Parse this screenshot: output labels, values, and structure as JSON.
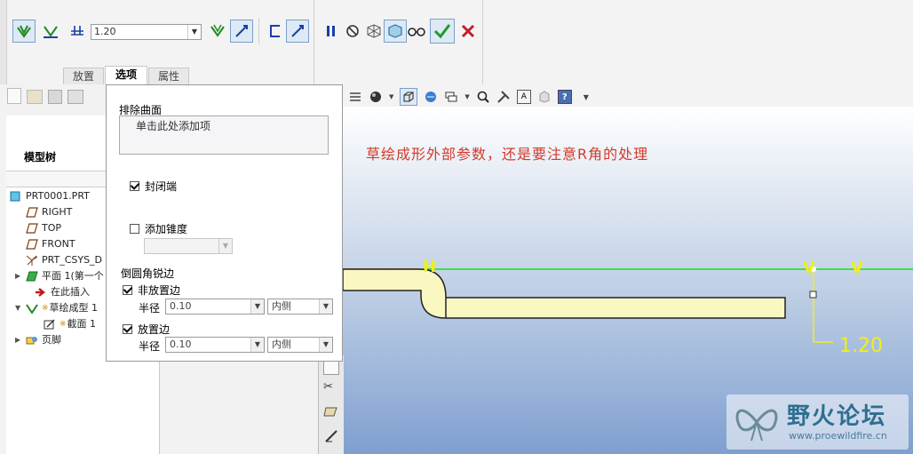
{
  "dashboard": {
    "dim_value": "1.20",
    "tabs": [
      {
        "label": "放置",
        "active": false
      },
      {
        "label": "选项",
        "active": true
      },
      {
        "label": "属性",
        "active": false
      }
    ]
  },
  "model_tree": {
    "title": "模型树",
    "items": [
      {
        "label": "PRT0001.PRT",
        "icon": "part-icon"
      },
      {
        "label": "RIGHT",
        "icon": "datum-plane-icon"
      },
      {
        "label": "TOP",
        "icon": "datum-plane-icon"
      },
      {
        "label": "FRONT",
        "icon": "datum-plane-icon"
      },
      {
        "label": "PRT_CSYS_D",
        "icon": "csys-icon"
      },
      {
        "label": "平面 1(第一个",
        "icon": "plane-feature-icon"
      },
      {
        "label": "在此插入",
        "icon": "insert-arrow-icon"
      },
      {
        "label": "草绘成型 1",
        "icon": "sketch-form-icon"
      },
      {
        "label": "截面 1",
        "icon": "section-icon"
      },
      {
        "label": "页脚",
        "icon": "footer-icon"
      }
    ]
  },
  "options_panel": {
    "exclude_surfaces_label": "排除曲面",
    "exclude_surfaces_placeholder": "单击此处添加项",
    "closed_ends_label": "封闭端",
    "closed_ends_checked": true,
    "add_taper_label": "添加锥度",
    "add_taper_checked": false,
    "taper_value": "",
    "round_edges_label": "倒圆角锐边",
    "non_placement_label": "非放置边",
    "non_placement_checked": true,
    "radius_label": "半径",
    "non_placement_radius": "0.10",
    "non_placement_side": "内侧",
    "placement_label": "放置边",
    "placement_checked": true,
    "placement_radius": "0.10",
    "placement_side": "内侧"
  },
  "canvas": {
    "annotation": "草绘成形外部参数，还是要注意R角的处理",
    "dimension": "1.20",
    "marker_h": "H",
    "marker_v1": "V",
    "marker_v2": "V"
  },
  "watermark": {
    "title": "野火论坛",
    "url": "www.proewildfire.cn"
  },
  "colors": {
    "accent_green": "#2e8b2e",
    "cancel_red": "#c0202a",
    "annotation_red": "#d23a2a",
    "dimension_yellow": "#f0f018",
    "sketch_fill": "#faf7c0",
    "sketch_line": "#18e018"
  }
}
